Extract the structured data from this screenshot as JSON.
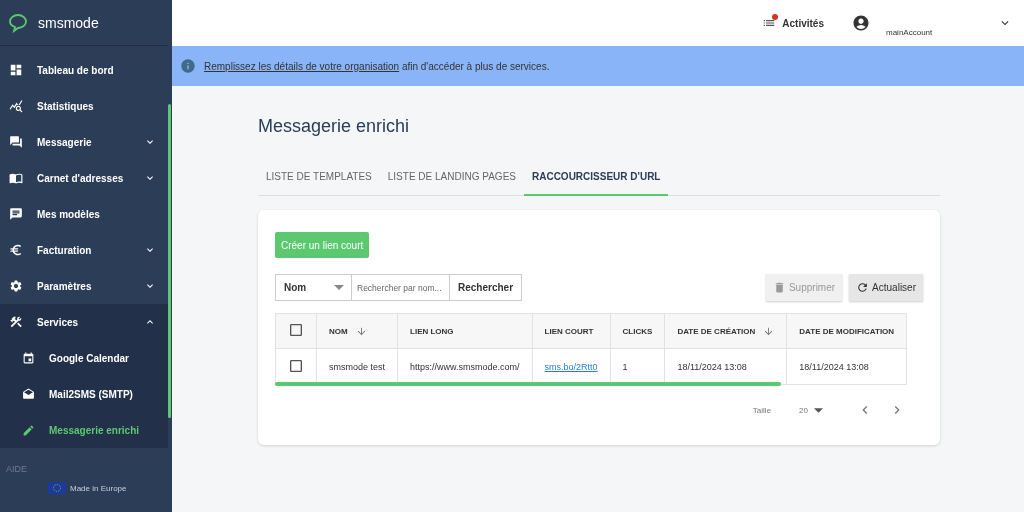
{
  "brand": "smsmode",
  "sidebar": {
    "items": [
      {
        "label": "Tableau de bord",
        "selected": false
      },
      {
        "label": "Statistiques",
        "selected": false
      },
      {
        "label": "Messagerie",
        "selected": false,
        "expanded": false
      },
      {
        "label": "Carnet d'adresses",
        "selected": false,
        "expanded": false
      },
      {
        "label": "Mes modèles",
        "selected": false
      },
      {
        "label": "Facturation",
        "selected": false,
        "expanded": false
      },
      {
        "label": "Paramètres",
        "selected": false,
        "expanded": false
      },
      {
        "label": "Services",
        "selected": false,
        "expanded": true,
        "children": [
          {
            "label": "Google Calendar",
            "selected": false
          },
          {
            "label": "Mail2SMS (SMTP)",
            "selected": false
          },
          {
            "label": "Messagerie enrichi",
            "selected": true
          }
        ]
      }
    ],
    "section": "AIDE",
    "footer": "Made in Europe"
  },
  "header": {
    "activities": "Activités",
    "account": "mainAccount"
  },
  "banner": {
    "link": "Remplissez les détails de votre organisation",
    "text": " afin d'accéder à plus de services."
  },
  "page_title": "Messagerie enrichi",
  "tabs": [
    {
      "label": "LISTE DE TEMPLATES",
      "selected": false
    },
    {
      "label": "LISTE DE LANDING PAGES",
      "selected": false
    },
    {
      "label": "RACCOURCISSEUR D'URL",
      "selected": true
    }
  ],
  "create_button": "Créer un lien court",
  "filter": {
    "field": "Nom",
    "placeholder": "Rechercher par nom...",
    "search_button": "Rechercher"
  },
  "delete_button": {
    "label": "Supprimer",
    "disabled": true
  },
  "refresh_button": "Actualiser",
  "table": {
    "select_all": {
      "checked": false
    },
    "columns": [
      {
        "label": "NOM",
        "sorted": true
      },
      {
        "label": "LIEN LONG",
        "sorted": false
      },
      {
        "label": "LIEN COURT",
        "sorted": false
      },
      {
        "label": "CLICKS",
        "sorted": false
      },
      {
        "label": "DATE DE CRÉATION",
        "sorted": true
      },
      {
        "label": "DATE DE MODIFICATION",
        "sorted": false
      }
    ],
    "rows": [
      {
        "checked": false,
        "cells": [
          "smsmode test",
          "https://www.smsmode.com/",
          "sms.bo/2Rtt0",
          "1",
          "18/11/2024 13:08",
          "18/11/2024 13:08"
        ]
      }
    ]
  },
  "pagination": {
    "size_label": "Taille",
    "size": "20"
  }
}
